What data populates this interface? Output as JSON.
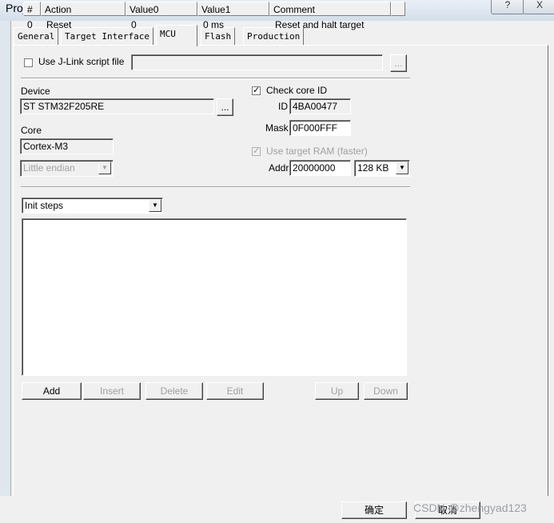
{
  "window": {
    "title": "Project settings",
    "help_glyph": "?",
    "close_glyph": "X"
  },
  "tabs": [
    {
      "label": "General"
    },
    {
      "label": "Target Interface"
    },
    {
      "label": "MCU"
    },
    {
      "label": "Flash"
    },
    {
      "label": "Production"
    }
  ],
  "script_file": {
    "label": "Use J-Link script file",
    "value": "",
    "browse_label": "..."
  },
  "device": {
    "label": "Device",
    "value": "ST STM32F205RE",
    "browse_label": "..."
  },
  "core": {
    "label": "Core",
    "value": "Cortex-M3"
  },
  "endian": {
    "value": "Little endian"
  },
  "check_core": {
    "label": "Check core ID",
    "checked": "✓",
    "id_label": "ID",
    "id_value": "4BA00477",
    "mask_label": "Mask",
    "mask_value": "0F000FFF"
  },
  "target_ram": {
    "label": "Use target RAM (faster)",
    "checked": "✓",
    "addr_label": "Addr",
    "addr_value": "20000000",
    "size_value": "128 KB"
  },
  "steps_select": {
    "value": "Init steps"
  },
  "steps_table": {
    "columns": [
      "#",
      "Action",
      "Value0",
      "Value1",
      "Comment"
    ],
    "rows": [
      [
        "0",
        "Reset",
        "0",
        "0 ms",
        "Reset and halt target"
      ]
    ]
  },
  "step_buttons": {
    "add": "Add",
    "insert": "Insert",
    "delete": "Delete",
    "edit": "Edit",
    "up": "Up",
    "down": "Down"
  },
  "footer": {
    "ok_label": "确定",
    "cancel_label": "取消",
    "watermark": "CSDN @zhengyad123"
  },
  "colors": {
    "dialog_bg": "#f0f0f0",
    "titlebar": "#d3deea",
    "disabled_text": "#a0a0a0"
  }
}
